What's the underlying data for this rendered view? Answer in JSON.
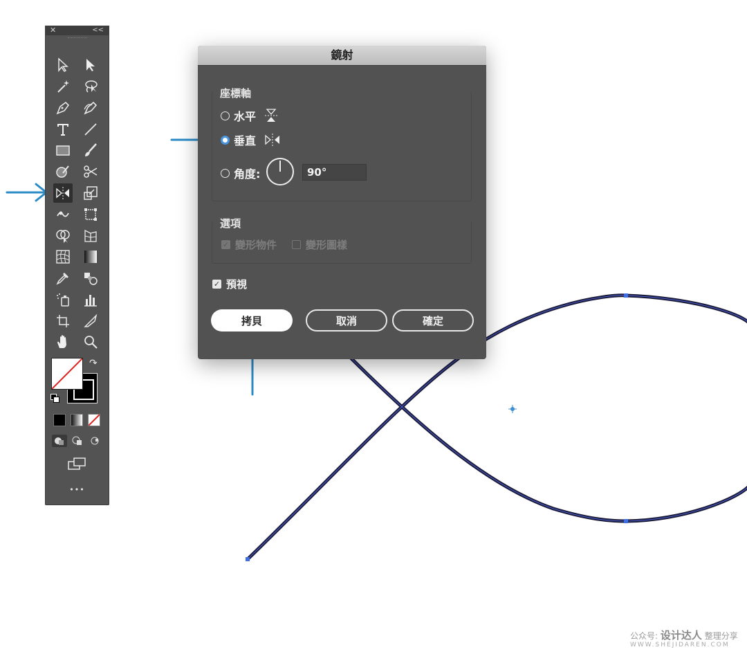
{
  "toolbar": {
    "close_glyph": "✕",
    "collapse_glyph": "<<",
    "more_glyph": "•••",
    "tools": [
      {
        "name": "selection-tool",
        "icon": "arrow-outline-icon"
      },
      {
        "name": "direct-selection-tool",
        "icon": "arrow-filled-icon"
      },
      {
        "name": "magic-wand-tool",
        "icon": "magic-wand-icon"
      },
      {
        "name": "lasso-tool",
        "icon": "lasso-icon"
      },
      {
        "name": "pen-tool",
        "icon": "pen-icon"
      },
      {
        "name": "curvature-tool",
        "icon": "curvature-pen-icon"
      },
      {
        "name": "type-tool",
        "icon": "type-icon",
        "text": "T"
      },
      {
        "name": "line-segment-tool",
        "icon": "line-icon"
      },
      {
        "name": "rectangle-tool",
        "icon": "rectangle-icon"
      },
      {
        "name": "paintbrush-tool",
        "icon": "brush-icon"
      },
      {
        "name": "shaper-tool",
        "icon": "shaper-icon"
      },
      {
        "name": "scissors-tool",
        "icon": "scissors-icon"
      },
      {
        "name": "reflect-tool",
        "icon": "reflect-icon",
        "active": true
      },
      {
        "name": "scale-tool",
        "icon": "scale-icon"
      },
      {
        "name": "warp-tool",
        "icon": "warp-icon"
      },
      {
        "name": "free-transform-tool",
        "icon": "free-transform-icon"
      },
      {
        "name": "shape-builder-tool",
        "icon": "shape-builder-icon"
      },
      {
        "name": "perspective-grid-tool",
        "icon": "perspective-grid-icon"
      },
      {
        "name": "mesh-tool",
        "icon": "mesh-icon"
      },
      {
        "name": "gradient-tool",
        "icon": "gradient-icon"
      },
      {
        "name": "eyedropper-tool",
        "icon": "eyedropper-icon"
      },
      {
        "name": "blend-tool",
        "icon": "blend-icon"
      },
      {
        "name": "symbol-sprayer-tool",
        "icon": "symbol-sprayer-icon"
      },
      {
        "name": "column-graph-tool",
        "icon": "column-graph-icon"
      },
      {
        "name": "artboard-tool",
        "icon": "artboard-icon"
      },
      {
        "name": "slice-tool",
        "icon": "slice-icon"
      },
      {
        "name": "hand-tool",
        "icon": "hand-icon"
      },
      {
        "name": "zoom-tool",
        "icon": "zoom-icon"
      }
    ]
  },
  "dialog": {
    "title": "鏡射",
    "axis_section": "座標軸",
    "horizontal_label": "水平",
    "vertical_label": "垂直",
    "angle_label": "角度:",
    "angle_value": "90°",
    "selected_axis": "vertical",
    "options_section": "選項",
    "transform_objects_label": "變形物件",
    "transform_patterns_label": "變形圖樣",
    "preview_label": "預視",
    "copy_button": "拷貝",
    "cancel_button": "取消",
    "ok_button": "確定"
  },
  "watermark": {
    "prefix": "公众号:",
    "brand": "设计达人",
    "suffix": "整理分享",
    "url": "WWW.SHEJIDAREN.COM"
  },
  "colors": {
    "annotation_arrow": "#2b8bc6",
    "path_stroke": "#1c1c3a",
    "path_highlight": "#4a5fd0",
    "anchor": "#3f6fe0",
    "radio_selected": "#4a95e0"
  }
}
